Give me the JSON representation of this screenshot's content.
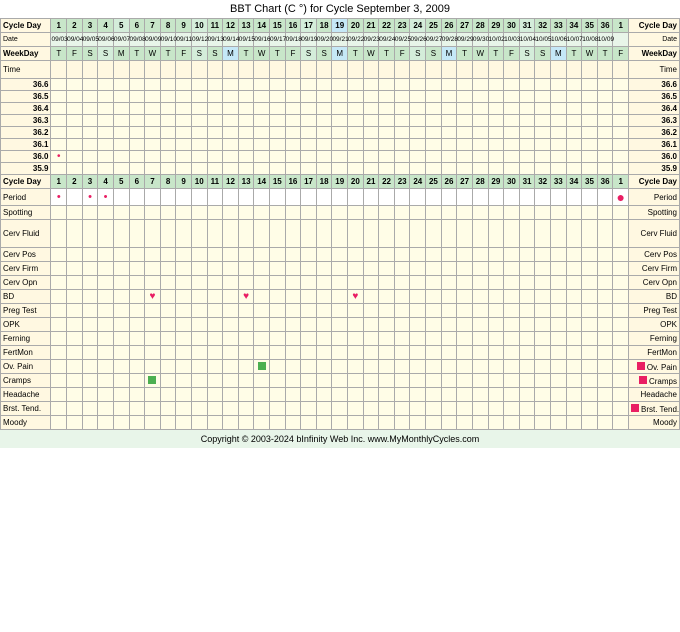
{
  "title": "BBT Chart (C °) for Cycle September 3, 2009",
  "copyright": "Copyright © 2003-2024 bInfinity Web Inc.   www.MyMonthlyCycles.com",
  "cycle_days": [
    "1",
    "2",
    "3",
    "4",
    "5",
    "6",
    "7",
    "8",
    "9",
    "10",
    "11",
    "12",
    "13",
    "14",
    "15",
    "16",
    "17",
    "18",
    "19",
    "20",
    "21",
    "22",
    "23",
    "24",
    "25",
    "26",
    "27",
    "28",
    "29",
    "30",
    "31",
    "32",
    "33",
    "34",
    "35",
    "36",
    "1"
  ],
  "dates": [
    "09/03",
    "09/04",
    "09/05",
    "09/06",
    "09/07",
    "09/08",
    "09/09",
    "09/10",
    "09/11",
    "09/12",
    "09/13",
    "09/14",
    "09/15",
    "09/16",
    "09/17",
    "09/18",
    "09/19",
    "09/20",
    "09/21",
    "09/22",
    "09/23",
    "09/24",
    "09/25",
    "09/26",
    "09/27",
    "09/28",
    "09/29",
    "09/30",
    "10/02",
    "10/03",
    "10/04",
    "10/05",
    "10/06",
    "10/07",
    "10/08",
    "10/09"
  ],
  "weekdays": [
    "T",
    "F",
    "S",
    "S",
    "M",
    "T",
    "W",
    "T",
    "F",
    "S",
    "S",
    "M",
    "T",
    "W",
    "T",
    "F",
    "S",
    "S",
    "M",
    "T",
    "W",
    "T",
    "F",
    "S",
    "S",
    "M",
    "T",
    "W",
    "T",
    "F",
    "S",
    "S",
    "M",
    "T",
    "W",
    "T",
    "F"
  ],
  "temp_labels": [
    "36.6",
    "36.5",
    "36.4",
    "36.3",
    "36.2",
    "36.1",
    "36.0",
    "35.9"
  ],
  "labels": {
    "cycle_day": "Cycle Day",
    "date": "Date",
    "weekday": "WeekDay",
    "time": "Time",
    "period": "Period",
    "spotting": "Spotting",
    "cerv_fluid": "Cerv Fluid",
    "cerv_pos": "Cerv Pos",
    "cerv_firm": "Cerv Firm",
    "cerv_opn": "Cerv Opn",
    "bd": "BD",
    "preg_test": "Preg Test",
    "opk": "OPK",
    "ferning": "Ferning",
    "fertmon": "FertMon",
    "ov_pain": "Ov. Pain",
    "cramps": "Cramps",
    "headache": "Headache",
    "brst_tend": "Brst. Tend.",
    "moody": "Moody"
  }
}
